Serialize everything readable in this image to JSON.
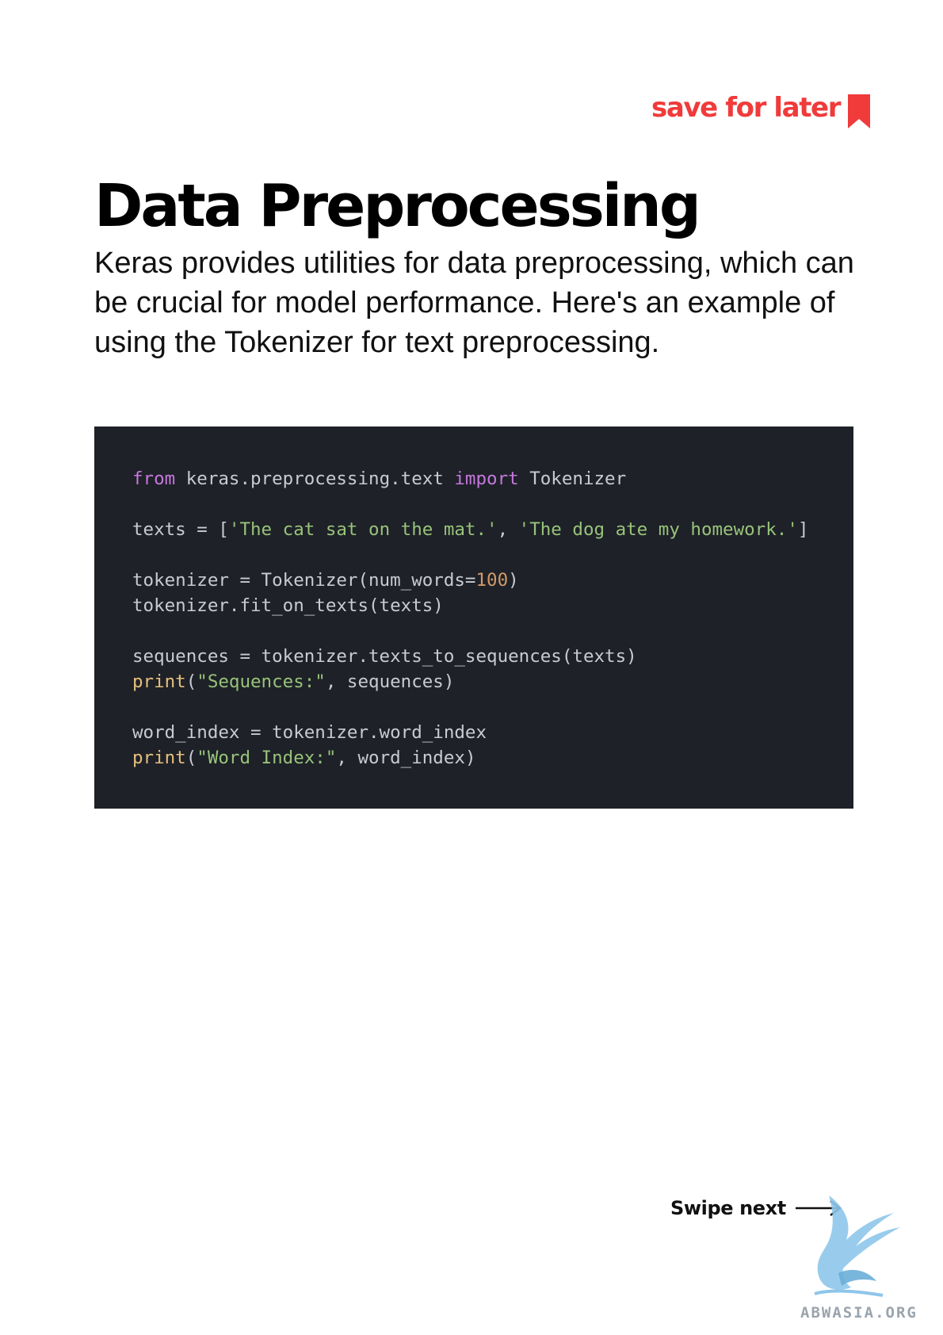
{
  "header": {
    "save_label": "save for later"
  },
  "title": "Data Preprocessing",
  "intro": "Keras provides utilities for data preprocessing, which can be crucial for model performance. Here's an example of using the Tokenizer for text preprocessing.",
  "code_lines": [
    [
      [
        "keyword",
        "from"
      ],
      [
        "plain",
        " keras.preprocessing.text "
      ],
      [
        "keyword",
        "import"
      ],
      [
        "plain",
        " Tokenizer"
      ]
    ],
    [],
    [
      [
        "plain",
        "texts = ["
      ],
      [
        "string",
        "'The cat sat on the mat.'"
      ],
      [
        "plain",
        ", "
      ],
      [
        "string",
        "'The dog ate my homework.'"
      ],
      [
        "plain",
        "]"
      ]
    ],
    [],
    [
      [
        "plain",
        "tokenizer = Tokenizer(num_words="
      ],
      [
        "number",
        "100"
      ],
      [
        "plain",
        ")"
      ]
    ],
    [
      [
        "plain",
        "tokenizer.fit_on_texts(texts)"
      ]
    ],
    [],
    [
      [
        "plain",
        "sequences = tokenizer.texts_to_sequences(texts)"
      ]
    ],
    [
      [
        "builtin",
        "print"
      ],
      [
        "plain",
        "("
      ],
      [
        "string",
        "\"Sequences:\""
      ],
      [
        "plain",
        ", sequences)"
      ]
    ],
    [],
    [
      [
        "plain",
        "word_index = tokenizer.word_index"
      ]
    ],
    [
      [
        "builtin",
        "print"
      ],
      [
        "plain",
        "("
      ],
      [
        "string",
        "\"Word Index:\""
      ],
      [
        "plain",
        ", word_index)"
      ]
    ]
  ],
  "footer": {
    "swipe_label": "Swipe next",
    "watermark": "ABWASIA.ORG"
  },
  "icons": {
    "bookmark": "bookmark-icon",
    "arrow": "arrow-right-icon",
    "logo": "dragon-logo-icon"
  },
  "colors": {
    "accent": "#f13a3a",
    "code_bg": "#1e2128",
    "keyword": "#c678dd",
    "string": "#98c379",
    "number": "#d19a66",
    "builtin": "#e5c07b",
    "plain": "#c8cbd2"
  }
}
